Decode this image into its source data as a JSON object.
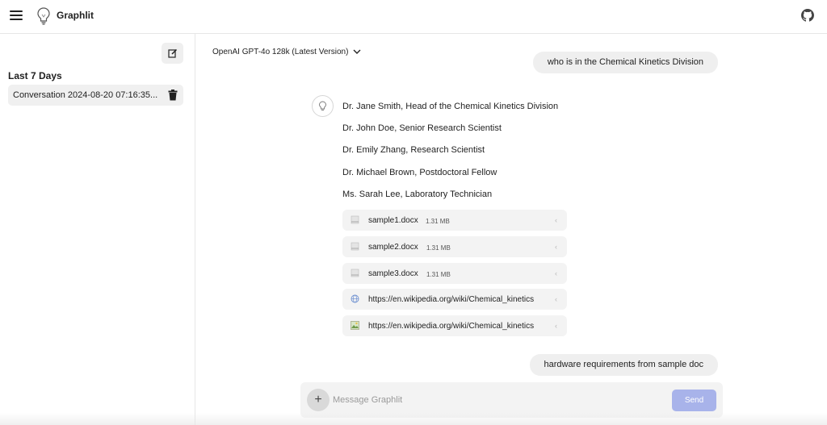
{
  "header": {
    "app_title": "Graphlit",
    "menu_icon": "hamburger-menu-icon",
    "logo_icon": "lightbulb-logo-icon",
    "github_icon": "github-icon"
  },
  "sidebar": {
    "new_chat_icon": "edit-icon",
    "section_title": "Last 7 Days",
    "conversations": [
      {
        "label": "Conversation 2024-08-20 07:16:35...",
        "icon": "trash-icon"
      }
    ]
  },
  "main": {
    "model_label": "OpenAI GPT-4o 128k (Latest Version)",
    "messages": {
      "user_1": "who is in the Chemical Kinetics Division",
      "assistant_lines": [
        "Dr. Jane Smith, Head of the Chemical Kinetics Division",
        "Dr. John Doe, Senior Research Scientist",
        "Dr. Emily Zhang, Research Scientist",
        "Dr. Michael Brown, Postdoctoral Fellow",
        "Ms. Sarah Lee, Laboratory Technician"
      ],
      "sources": [
        {
          "name": "sample1.docx",
          "size": "1.31 MB",
          "icon": "document-icon"
        },
        {
          "name": "sample2.docx",
          "size": "1.31 MB",
          "icon": "document-icon"
        },
        {
          "name": "sample3.docx",
          "size": "1.31 MB",
          "icon": "document-icon"
        },
        {
          "name": "https://en.wikipedia.org/wiki/Chemical_kinetics",
          "size": "",
          "icon": "globe-icon"
        },
        {
          "name": "https://en.wikipedia.org/wiki/Chemical_kinetics",
          "size": "",
          "icon": "image-icon"
        }
      ],
      "user_2": "hardware requirements from sample doc"
    },
    "composer": {
      "placeholder": "Message Graphlit",
      "send_label": "Send",
      "attach_label": "+"
    }
  },
  "colors": {
    "send_button": "#a8b3ea",
    "bubble_bg": "#efefef",
    "source_bg": "#f3f3f3"
  }
}
